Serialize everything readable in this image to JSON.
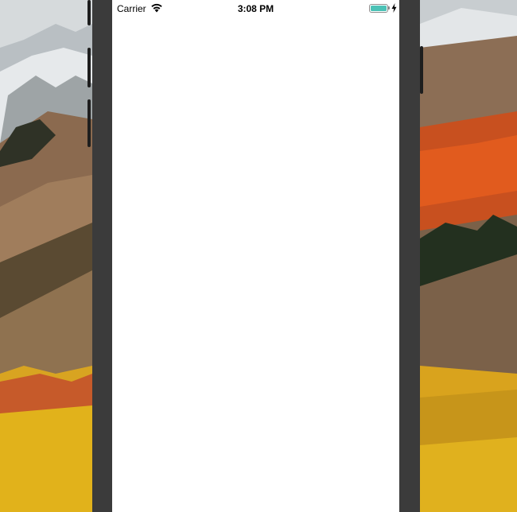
{
  "status_bar": {
    "carrier": "Carrier",
    "time": "3:08 PM",
    "battery_level": 1.0,
    "charging": true
  },
  "icons": {
    "wifi": "wifi-icon",
    "battery": "battery-icon",
    "charging": "charging-bolt-icon"
  },
  "colors": {
    "battery_fill": "#4cc2b6",
    "device_frame": "#3b3b3b",
    "screen": "#ffffff"
  }
}
